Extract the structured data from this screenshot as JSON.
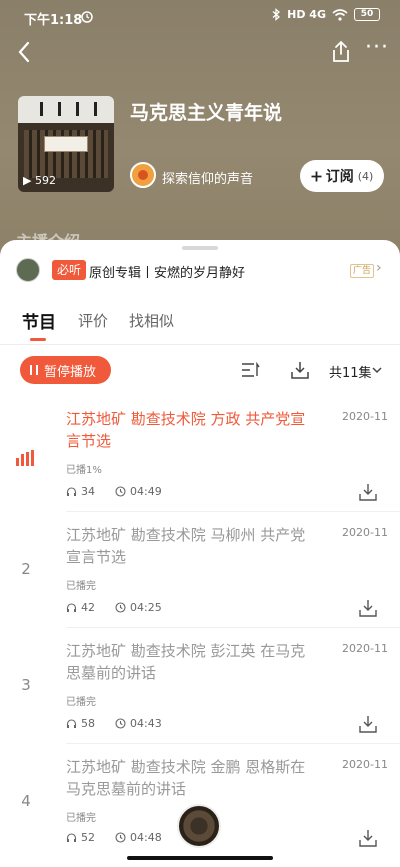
{
  "status_bar": {
    "time": "下午1:18",
    "network": "HD 4G",
    "battery": "50"
  },
  "album": {
    "title": "马克思主义青年说",
    "cover_plays": "592",
    "author": "探索信仰的声音",
    "subscribe_label": "订阅",
    "subscribe_count": "(4)",
    "intro_label": "主播介绍"
  },
  "promo": {
    "tag": "必听",
    "text": "原创专辑丨安燃的岁月静好",
    "ad_label": "广告"
  },
  "tabs": [
    {
      "label": "节目"
    },
    {
      "label": "评价"
    },
    {
      "label": "找相似"
    }
  ],
  "controls": {
    "pause_label": "暂停播放",
    "episode_count": "共11集"
  },
  "episodes": [
    {
      "index": "",
      "title": "江苏地矿 勘查技术院 方政 共产党宣言节选",
      "date": "2020-11",
      "status": "已播1%",
      "plays": "34",
      "duration": "04:49"
    },
    {
      "index": "2",
      "title": "江苏地矿 勘查技术院 马柳州 共产党宣言节选",
      "date": "2020-11",
      "status": "已播完",
      "plays": "42",
      "duration": "04:25"
    },
    {
      "index": "3",
      "title": "江苏地矿 勘查技术院 彭江英 在马克思墓前的讲话",
      "date": "2020-11",
      "status": "已播完",
      "plays": "58",
      "duration": "04:43"
    },
    {
      "index": "4",
      "title": "江苏地矿 勘查技术院 金鹏 恩格斯在马克思墓前的讲话",
      "date": "2020-11",
      "status": "已播完",
      "plays": "52",
      "duration": "04:48"
    }
  ],
  "icons": {
    "back": "back-arrow-icon",
    "share": "share-icon",
    "more": "more-icon",
    "sort": "sort-icon",
    "download": "download-icon",
    "headphones": "headphones-icon",
    "clock": "clock-icon"
  },
  "colors": {
    "accent": "#f05a3a",
    "header": "#8f846c"
  }
}
